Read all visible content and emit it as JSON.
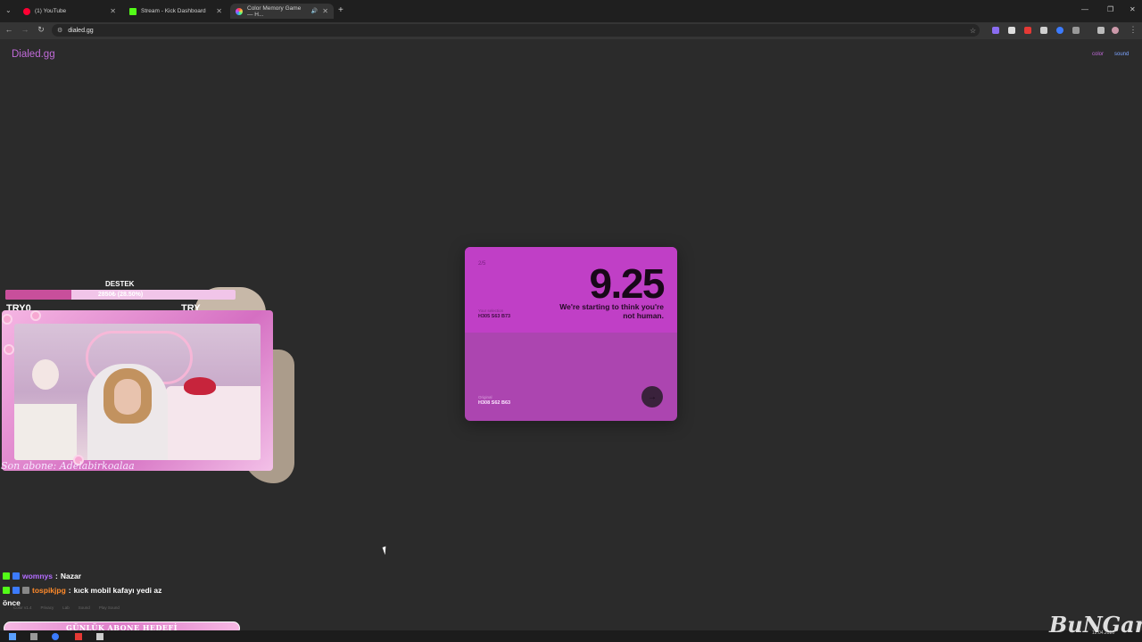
{
  "browser": {
    "tabs": [
      {
        "title": "(1) YouTube",
        "favicon_color": "#ff0033"
      },
      {
        "title": "Stream - Kick Dashboard",
        "favicon_color": "#53fc18"
      },
      {
        "title": "Color Memory Game — H...",
        "favicon_color": "#c06ad8",
        "active": true
      }
    ],
    "address": "dialed.gg"
  },
  "site": {
    "logo": "Dialed.gg",
    "nav": {
      "color": "color",
      "sound": "sound"
    }
  },
  "card": {
    "progress": "2/5",
    "score": "9.25",
    "message": "We're starting to think you're not human.",
    "your_selection_label": "Your selection",
    "your_selection_value": "H305 S63 B73",
    "original_label": "Original",
    "original_value": "H308 S62 B63",
    "top_color": "#c03fc6",
    "bottom_color": "#ac45b0"
  },
  "overlay": {
    "destek_title": "DESTEK",
    "destek_text": "2850₺ (28.50%)",
    "destek_progress": 0.285,
    "try_left": "TRY0",
    "try_right": "TRY",
    "son_abone": "Son abone: Adelabirkoalaa",
    "goal": "GÜNLÜK ABONE HEDEFİ"
  },
  "chat": [
    {
      "user": "womnys",
      "message": "Nazar",
      "color": "#b36cff"
    },
    {
      "user": "tospikjpg",
      "message": "kıck mobil kafayı yedi az",
      "color": "#ff8a2a"
    },
    {
      "user": "",
      "message": "önce",
      "color": "#ffffff"
    }
  ],
  "footer": {
    "links": [
      "Color v1.4",
      "Privacy",
      "Lab",
      "Sound",
      "Play Sound"
    ]
  },
  "clock": {
    "date": "12.04.2026"
  },
  "watermark": "BuNGame"
}
